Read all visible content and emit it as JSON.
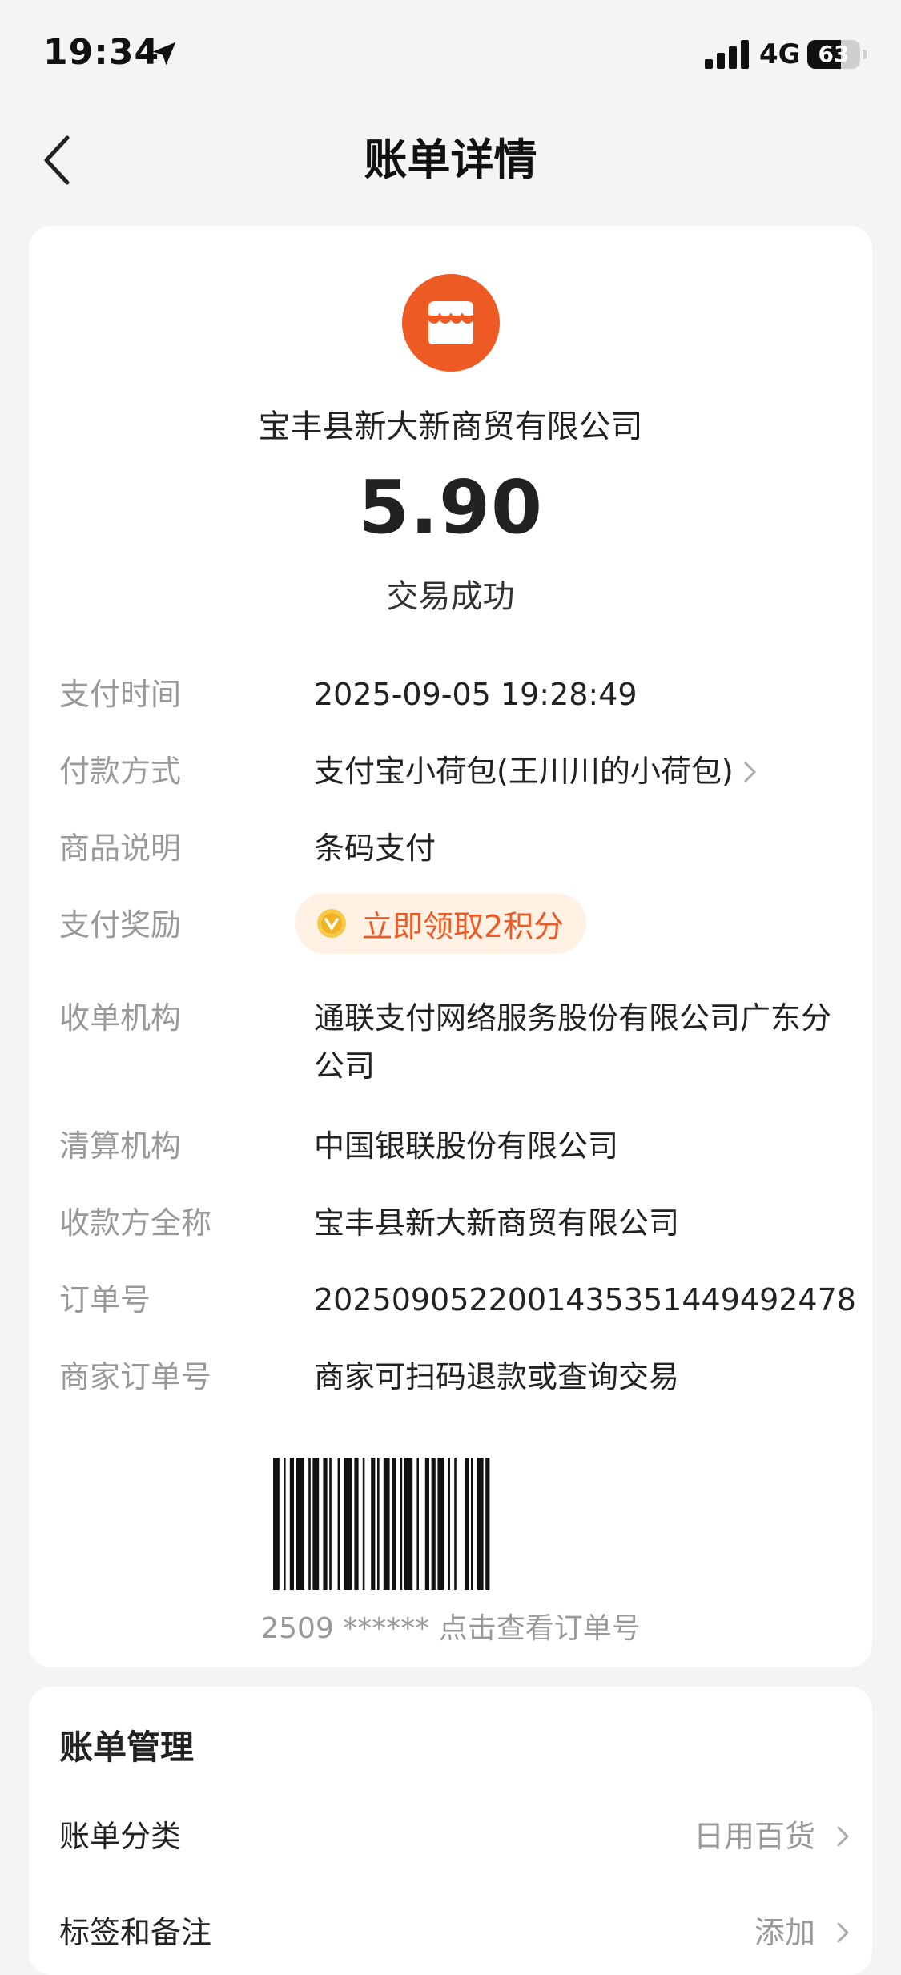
{
  "status_bar": {
    "time": "19:34",
    "network": "4G",
    "battery_level": "63",
    "battery_fraction": 0.63
  },
  "nav": {
    "title": "账单详情"
  },
  "transaction": {
    "merchant_name": "宝丰县新大新商贸有限公司",
    "amount": "5.90",
    "status": "交易成功"
  },
  "details": [
    {
      "label": "支付时间",
      "value": "2025-09-05 19:28:49"
    },
    {
      "label": "付款方式",
      "value": "支付宝小荷包(王川川的小荷包)"
    },
    {
      "label": "商品说明",
      "value": "条码支付"
    },
    {
      "label": "支付奖励",
      "value": "立即领取2积分"
    },
    {
      "label": "收单机构",
      "value": "通联支付网络服务股份有限公司广东分公司"
    },
    {
      "label": "清算机构",
      "value": "中国银联股份有限公司"
    },
    {
      "label": "收款方全称",
      "value": "宝丰县新大新商贸有限公司"
    },
    {
      "label": "订单号",
      "value": "2025090522001435351449492478"
    },
    {
      "label": "商家订单号",
      "value": "商家可扫码退款或查询交易"
    }
  ],
  "barcode": {
    "caption": "2509 ****** 点击查看订单号"
  },
  "bill_management": {
    "title": "账单管理",
    "rows": [
      {
        "label": "账单分类",
        "value": "日用百货"
      },
      {
        "label": "标签和备注",
        "value": "添加"
      }
    ]
  },
  "colors": {
    "accent": "#ee5a24",
    "reward_bg": "#fff1e4",
    "label_gray": "#999999",
    "page_bg": "#f4f4f4"
  },
  "icons": {
    "back": "chevron-left-icon",
    "merchant": "store-icon",
    "coin": "coin-icon",
    "more": "chevron-right-icon",
    "location": "location-arrow-icon",
    "signal": "signal-icon"
  }
}
